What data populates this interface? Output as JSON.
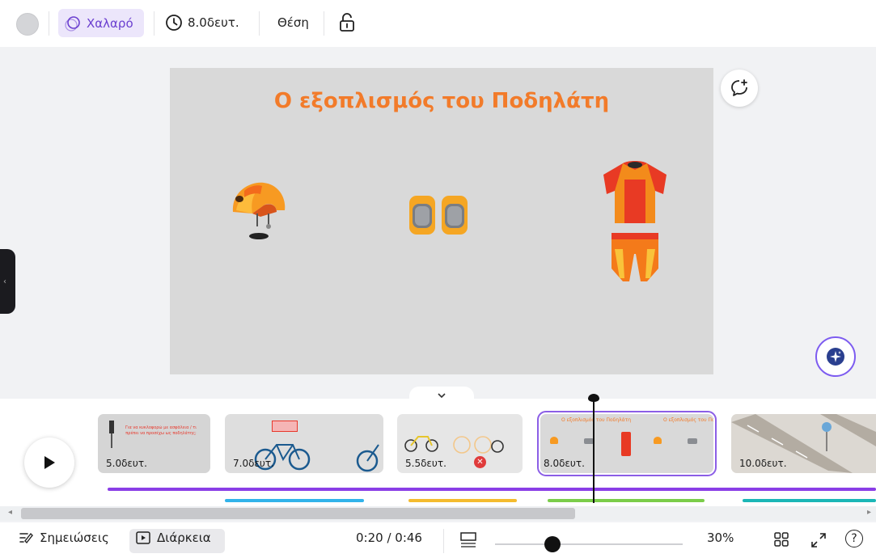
{
  "toolbar": {
    "animation_label": "Χαλαρό",
    "duration_label": "8.0δευτ.",
    "position_label": "Θέση"
  },
  "slide": {
    "title": "Ο εξοπλισμός του Ποδηλάτη",
    "items": [
      "helmet-icon",
      "knee-pads-icon",
      "cycling-kit-icon"
    ],
    "accent_color": "#f27b2a"
  },
  "timeline": {
    "clips": [
      {
        "duration": "5.0δευτ.",
        "caption": "Για να κυκλοφορώ με ασφάλεια / τι πρέπει να προσέχω ως ποδηλάτης;"
      },
      {
        "duration": "7.0δευτ.",
        "caption": ""
      },
      {
        "duration": "5.5δευτ.",
        "caption": ""
      },
      {
        "duration": "8.0δευτ.",
        "caption": "Ο εξοπλισμός του Ποδηλάτη"
      },
      {
        "duration": "10.0δευτ.",
        "caption": ""
      }
    ],
    "selected_clip_index": 3
  },
  "bottombar": {
    "notes_label": "Σημειώσεις",
    "duration_label": "Διάρκεια",
    "time_readout": "0:20 / 0:46",
    "zoom_label": "30%",
    "help_label": "?"
  },
  "colors": {
    "accent_purple": "#8b5ee6",
    "track_purple": "#8a3ee6",
    "track_blue": "#31b3ea",
    "track_yellow": "#f4bb2e",
    "track_green": "#7bcd4a",
    "track_teal": "#1bb7b7"
  }
}
